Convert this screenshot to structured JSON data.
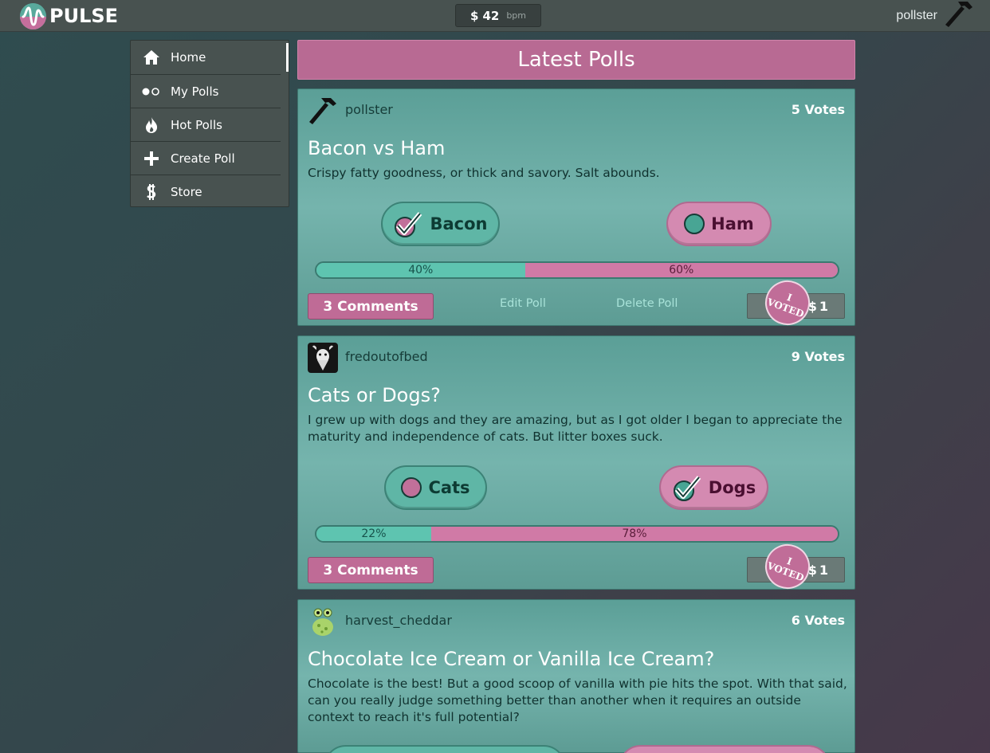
{
  "header": {
    "logo_text": "PULSE",
    "bpm_value": "42",
    "bpm_unit": "bpm",
    "coin_symbol": "$",
    "username": "pollster"
  },
  "sidebar": {
    "items": [
      {
        "label": "Home",
        "icon": "home-icon",
        "active": true
      },
      {
        "label": "My Polls",
        "icon": "toggle-dots-icon"
      },
      {
        "label": "Hot Polls",
        "icon": "flame-icon"
      },
      {
        "label": "Create Poll",
        "icon": "plus-icon"
      },
      {
        "label": "Store",
        "icon": "coin-icon"
      }
    ]
  },
  "main": {
    "heading": "Latest Polls",
    "polls": [
      {
        "author": "pollster",
        "avatar": "hammer-icon",
        "votes": "5 Votes",
        "title": "Bacon vs Ham",
        "description": "Crispy fatty goodness, or thick and savory. Salt abounds.",
        "option_a": "Bacon",
        "option_b": "Ham",
        "pct_a": "40%",
        "pct_b": "60%",
        "share_a": 0.4,
        "voted_for": "a",
        "comments": "3 Comments",
        "edit_label": "Edit Poll",
        "delete_label": "Delete Poll",
        "stamp_top": "I",
        "stamp_bottom": "VOTED",
        "coins": "1"
      },
      {
        "author": "fredoutofbed",
        "avatar": "goat-avatar",
        "votes": "9 Votes",
        "title": "Cats or Dogs?",
        "description": "I grew up with dogs and they are amazing, but as I got older I began to appreciate the maturity and independence of cats. But litter boxes suck.",
        "option_a": "Cats",
        "option_b": "Dogs",
        "pct_a": "22%",
        "pct_b": "78%",
        "share_a": 0.22,
        "voted_for": "b",
        "comments": "3 Comments",
        "stamp_top": "I",
        "stamp_bottom": "VOTED",
        "coins": "1"
      },
      {
        "author": "harvest_cheddar",
        "avatar": "alien-avatar",
        "votes": "6 Votes",
        "title": "Chocolate Ice Cream or Vanilla Ice Cream?",
        "description": "Chocolate is the best! But a good scoop of vanilla with pie hits the spot. With that said, can you really judge something better than another when it requires an outside context to reach it's full potential?"
      }
    ]
  },
  "colors": {
    "teal": "#5fb6a6",
    "pink": "#d48ab1",
    "header_bg": "#485250",
    "heading_bg": "#b86a93"
  }
}
